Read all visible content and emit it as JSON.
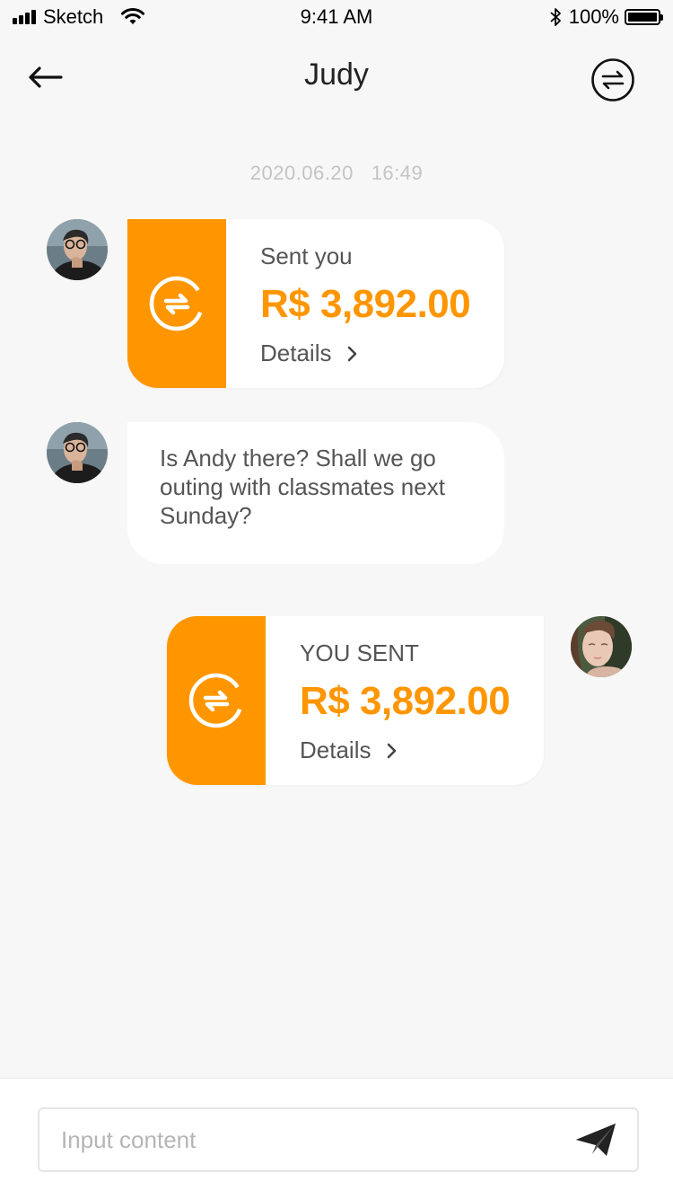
{
  "status_bar": {
    "carrier": "Sketch",
    "time": "9:41 AM",
    "battery": "100%",
    "icons": [
      "signal-icon",
      "wifi-icon",
      "bluetooth-icon",
      "battery-icon"
    ]
  },
  "nav": {
    "title": "Judy",
    "back_icon": "arrow-left-icon",
    "action_icon": "exchange-icon"
  },
  "chat": {
    "timestamp": "2020.06.20   16:49",
    "messages": [
      {
        "type": "transfer",
        "direction": "received",
        "label": "Sent you",
        "amount": "R$ 3,892.00",
        "details": "Details",
        "icon": "transfer-icon"
      },
      {
        "type": "text",
        "direction": "received",
        "text": "Is Andy there? Shall we go outing with classmates next Sunday?"
      },
      {
        "type": "transfer",
        "direction": "sent",
        "label": "YOU SENT",
        "amount": "R$ 3,892.00",
        "details": "Details",
        "icon": "transfer-icon"
      }
    ]
  },
  "composer": {
    "placeholder": "Input content",
    "value": "",
    "send_icon": "send-icon"
  },
  "colors": {
    "accent": "#ff9600",
    "background": "#f7f7f7",
    "bubble": "#ffffff",
    "timestamp": "#c4c4c4"
  }
}
